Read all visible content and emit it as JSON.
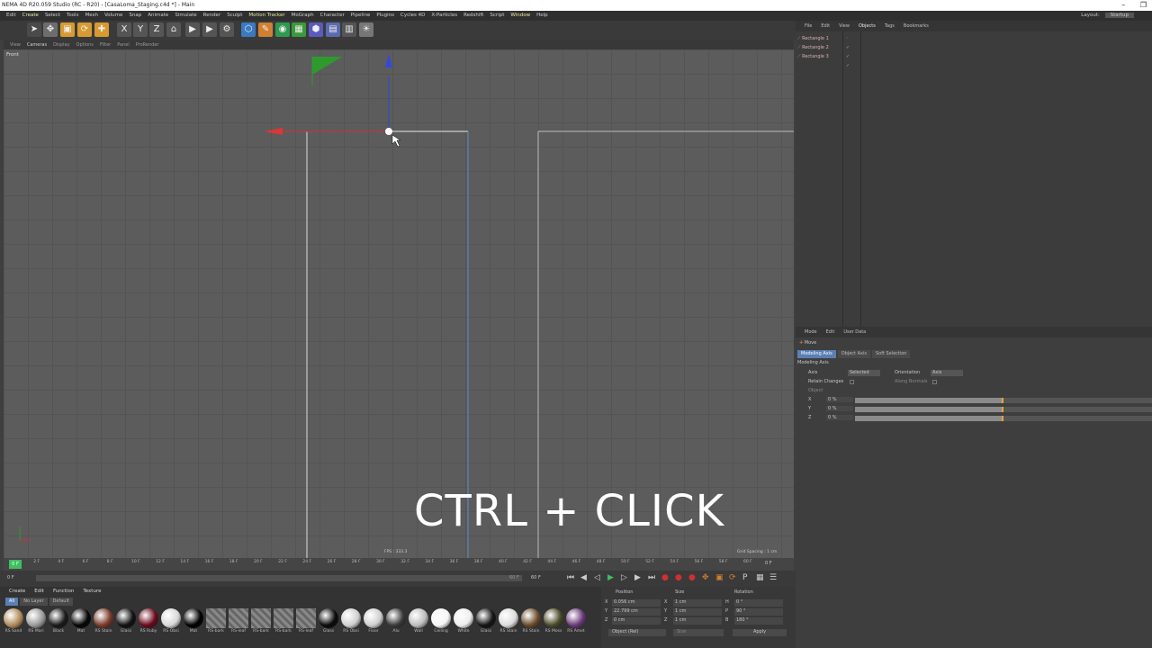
{
  "window": {
    "title": "NEMA 4D R20.059 Studio (RC - R20) - [CasaLoma_Staging.c4d *] - Main",
    "controls": [
      "–",
      "❐"
    ]
  },
  "menu": {
    "items": [
      "Edit",
      "Create",
      "Select",
      "Tools",
      "Mesh",
      "Volume",
      "Snap",
      "Animate",
      "Simulate",
      "Render",
      "Sculpt",
      "Motion Tracker",
      "MoGraph",
      "Character",
      "Pipeline",
      "Plugins",
      "Cycles 4D",
      "X-Particles",
      "Redshift",
      "Script",
      "Window",
      "Help"
    ],
    "highlighted": [
      "Create",
      "Motion Tracker",
      "Window"
    ],
    "layout_label": "Layout:",
    "layout_value": "Startup"
  },
  "toolbar": {
    "icons": [
      "select-arrow-icon",
      "move-icon",
      "scale-icon",
      "rotate-icon",
      "add-icon",
      "x-axis-icon",
      "y-axis-icon",
      "z-axis-icon",
      "coord-system-icon",
      "render-view-icon",
      "render-picture-icon",
      "render-settings-icon",
      "cube-icon",
      "pen-icon",
      "subdivision-icon",
      "array-icon",
      "deformer-icon",
      "scene-icon",
      "camera-icon",
      "light-icon"
    ]
  },
  "viewport_menu": {
    "items": [
      "View",
      "Cameras",
      "Display",
      "Options",
      "Filter",
      "Panel",
      "ProRender"
    ],
    "active": "Cameras"
  },
  "viewport": {
    "label": "Front",
    "fps": "FPS : 333.3",
    "grid_spacing": "Grid Spacing : 1 cm",
    "overlay_caption": "CTRL + CLICK"
  },
  "timeline": {
    "ticks": [
      "0 F",
      "2 F",
      "4 F",
      "6 F",
      "8 F",
      "10 F",
      "12 F",
      "14 F",
      "16 F",
      "18 F",
      "20 F",
      "22 F",
      "24 F",
      "26 F",
      "28 F",
      "30 F",
      "32 F",
      "34 F",
      "36 F",
      "38 F",
      "40 F",
      "42 F",
      "44 F",
      "46 F",
      "48 F",
      "50 F",
      "52 F",
      "54 F",
      "56 F",
      "58 F",
      "60 F"
    ],
    "current": "0 F",
    "end_field": "0 F",
    "start_field": "0 F",
    "max_field": "60 F",
    "range_end": "60 F"
  },
  "material_panel": {
    "menu": [
      "Create",
      "Edit",
      "Function",
      "Texture"
    ],
    "filters": [
      "All",
      "No Layer",
      "Default"
    ],
    "materials": [
      {
        "label": "RS Sand",
        "color": "#b08a5a"
      },
      {
        "label": "RS Mari",
        "color": "#9a9a9a"
      },
      {
        "label": "Black",
        "color": "#1a1a1a"
      },
      {
        "label": "Mat",
        "color": "#050505"
      },
      {
        "label": "RS Stain",
        "color": "#7a3a2a"
      },
      {
        "label": "Glass",
        "color": "#111111"
      },
      {
        "label": "RS Ruby",
        "color": "#6a0a1a"
      },
      {
        "label": "RS Obsi",
        "color": "#d8d8d8"
      },
      {
        "label": "Mat",
        "color": "#000000"
      },
      {
        "label": "RS-bark",
        "color": "#777777"
      },
      {
        "label": "RS-leaf",
        "color": "#777777"
      },
      {
        "label": "RS-bark",
        "color": "#777777"
      },
      {
        "label": "RS-bark",
        "color": "#777777"
      },
      {
        "label": "RS-leaf",
        "color": "#777777"
      },
      {
        "label": "Glass",
        "color": "#0a0a0a"
      },
      {
        "label": "RS Obsi",
        "color": "#d0d0d0"
      },
      {
        "label": "Floor",
        "color": "#cfcfcf"
      },
      {
        "label": "Alu",
        "color": "#3a3a3a"
      },
      {
        "label": "Wall",
        "color": "#bdbdbd"
      },
      {
        "label": "Ceiling",
        "color": "#f5f5f5"
      },
      {
        "label": "White",
        "color": "#eeeeee"
      },
      {
        "label": "Glass",
        "color": "#151515"
      },
      {
        "label": "RS Stain",
        "color": "#dcdcdc"
      },
      {
        "label": "RS Stain",
        "color": "#6a4a2a"
      },
      {
        "label": "RS Moss",
        "color": "#4a4a2a"
      },
      {
        "label": "RS Amet",
        "color": "#6a3a7a"
      }
    ]
  },
  "coord_panel": {
    "headers": [
      "Position",
      "Size",
      "Rotation"
    ],
    "rows": [
      {
        "axis": "X",
        "pos": "0.056 cm",
        "size_axis": "X",
        "size": "1 cm",
        "rot_axis": "H",
        "rot": "0 °"
      },
      {
        "axis": "Y",
        "pos": "22.799 cm",
        "size_axis": "Y",
        "size": "1 cm",
        "rot_axis": "P",
        "rot": "90 °"
      },
      {
        "axis": "Z",
        "pos": "0 cm",
        "size_axis": "Z",
        "size": "1 cm",
        "rot_axis": "B",
        "rot": "180 °"
      }
    ],
    "mode": "Object (Rel)",
    "size_mode": "Size",
    "apply": "Apply"
  },
  "object_panel": {
    "menu": [
      "File",
      "Edit",
      "View",
      "Objects",
      "Tags",
      "Bookmarks"
    ],
    "active": "Objects",
    "objects": [
      "Rectangle 1",
      "Rectangle 2",
      "Rectangle 3"
    ]
  },
  "attribute_panel": {
    "menu": [
      "Mode",
      "Edit",
      "User Data"
    ],
    "tool": "Move",
    "tabs": [
      "Modeling Axis",
      "Object Axis",
      "Soft Selection"
    ],
    "active_tab": "Modeling Axis",
    "section": "Modeling Axis",
    "axis_label": "Axis",
    "axis_value": "Selected",
    "orientation_label": "Orientation",
    "orientation_value": "Axis",
    "retain_label": "Retain Changes",
    "along_normals_label": "Along Normals",
    "object_label": "Object",
    "sliders": [
      {
        "axis": "X",
        "value": "0 %",
        "fraction": 0.5
      },
      {
        "axis": "Y",
        "value": "0 %",
        "fraction": 0.5
      },
      {
        "axis": "Z",
        "value": "0 %",
        "fraction": 0.5
      }
    ]
  }
}
